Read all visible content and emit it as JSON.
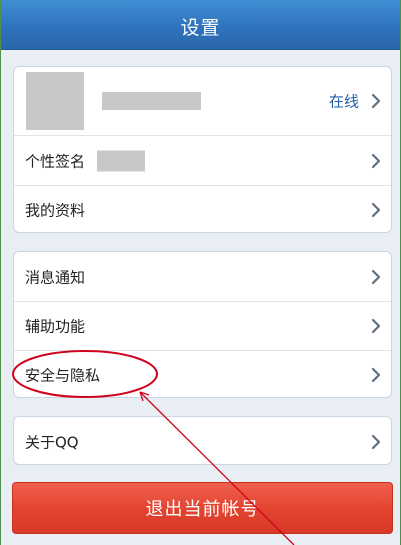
{
  "header": {
    "title": "设置"
  },
  "account_group": {
    "status": "在线",
    "items": [
      {
        "label": "个性签名"
      },
      {
        "label": "我的资料"
      }
    ]
  },
  "settings_group": {
    "items": [
      {
        "label": "消息通知"
      },
      {
        "label": "辅助功能"
      },
      {
        "label": "安全与隐私"
      }
    ]
  },
  "about_group": {
    "items": [
      {
        "label": "关于QQ"
      }
    ]
  },
  "logout": {
    "label": "退出当前帐号"
  },
  "icons": {
    "row_chevron": "chevron-right-icon"
  },
  "colors": {
    "title_bar": "#2f73bd",
    "status_text": "#1f5fa8",
    "logout_button": "#e2432f",
    "annotation": "#d0021b"
  }
}
